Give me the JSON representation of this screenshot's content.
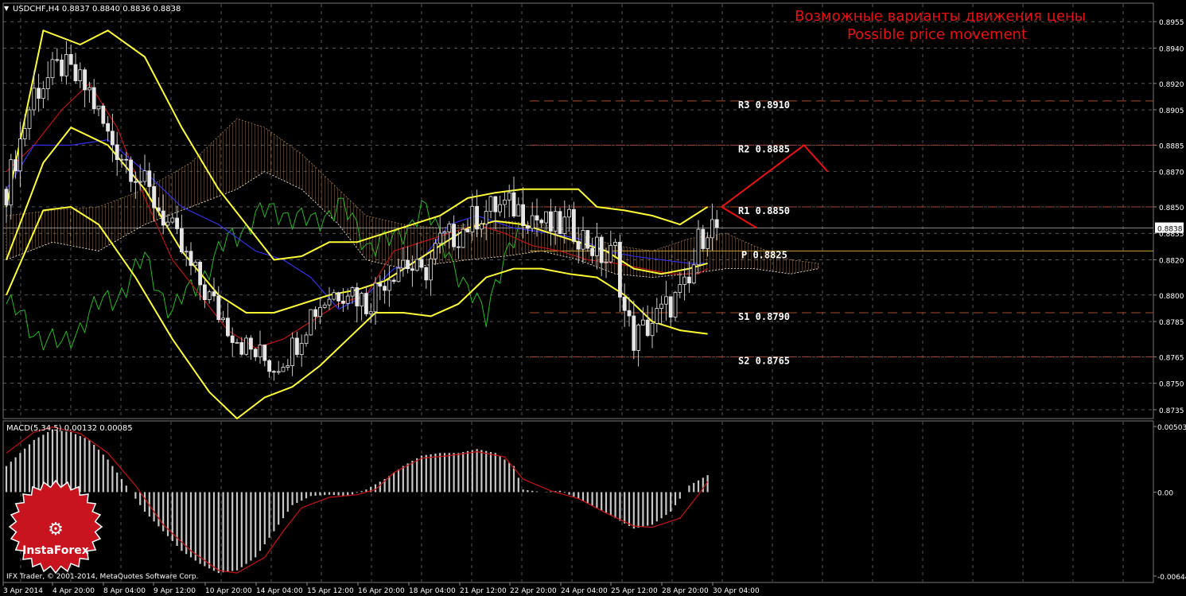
{
  "header": {
    "symbol_info": "USDCHF,H4  0.8837 0.8840 0.8836 0.8838",
    "macd_info": "MACD(5,34,5) 0.00132 0.00085",
    "copyright": "IFX Trader, © 2001-2014, MetaQuotes Software Corp."
  },
  "annotation": {
    "title_ru": "Возможные варианты движения цены",
    "title_en": "Possible price movement"
  },
  "logo": {
    "text": "InstaForex"
  },
  "colors": {
    "background": "#000000",
    "grid": "#8a8a8a",
    "bollinger": "#ffff33",
    "candle": "#e6e6e6",
    "tenkan": "#3333ff",
    "kijun": "#cc1111",
    "chikou": "#22bb22",
    "kumo_a": "#b08a5a",
    "kumo_b": "#ffffff",
    "level_line": "#a84a2a",
    "pivot_line": "#c8a02a",
    "bid_line": "#9a9a9a",
    "forecast": "#e81010",
    "annotation": "#e81010",
    "macd_hist": "#c8c8c8",
    "macd_signal": "#cc1111",
    "axis_text": "#ffffff"
  },
  "chart_data": [
    {
      "type": "candlestick",
      "title": "USDCHF,H4",
      "ylim": [
        0.873,
        0.8965
      ],
      "y_ticks": [
        "0.8955",
        "0.8940",
        "0.8920",
        "0.8905",
        "0.8885",
        "0.8870",
        "0.8850",
        "0.8835",
        "0.8820",
        "0.8800",
        "0.8785",
        "0.8765",
        "0.8750",
        "0.8735"
      ],
      "current_price_label": "0.8838",
      "x_ticks": [
        "3 Apr 2014",
        "4 Apr 20:00",
        "8 Apr 04:00",
        "9 Apr 12:00",
        "10 Apr 20:00",
        "14 Apr 04:00",
        "15 Apr 12:00",
        "16 Apr 20:00",
        "18 Apr 04:00",
        "21 Apr 12:00",
        "22 Apr 20:00",
        "24 Apr 04:00",
        "25 Apr 12:00",
        "28 Apr 20:00",
        "30 Apr 04:00"
      ],
      "levels": [
        {
          "label": "R3  0.8910",
          "value": 0.891
        },
        {
          "label": "R2  0.8885",
          "value": 0.8885
        },
        {
          "label": "R1  0.8850",
          "value": 0.885
        },
        {
          "label": "P  0.8825",
          "value": 0.8825
        },
        {
          "label": "S1  0.8790",
          "value": 0.879
        },
        {
          "label": "S2  0.8765",
          "value": 0.8765
        }
      ],
      "current_price": 0.8838,
      "close_path": [
        [
          0,
          0.886
        ],
        [
          6,
          0.8915
        ],
        [
          12,
          0.893
        ],
        [
          18,
          0.8915
        ],
        [
          22,
          0.889
        ],
        [
          28,
          0.887
        ],
        [
          34,
          0.8845
        ],
        [
          40,
          0.8815
        ],
        [
          46,
          0.879
        ],
        [
          52,
          0.877
        ],
        [
          58,
          0.876
        ],
        [
          62,
          0.877
        ],
        [
          66,
          0.879
        ],
        [
          70,
          0.88
        ],
        [
          74,
          0.8805
        ],
        [
          78,
          0.8795
        ],
        [
          82,
          0.881
        ],
        [
          86,
          0.882
        ],
        [
          90,
          0.881
        ],
        [
          94,
          0.883
        ],
        [
          98,
          0.8835
        ],
        [
          102,
          0.8845
        ],
        [
          106,
          0.885
        ],
        [
          110,
          0.885
        ],
        [
          114,
          0.8845
        ],
        [
          118,
          0.8838
        ],
        [
          122,
          0.884
        ],
        [
          126,
          0.883
        ],
        [
          130,
          0.882
        ],
        [
          132,
          0.8825
        ],
        [
          134,
          0.879
        ],
        [
          136,
          0.8775
        ],
        [
          140,
          0.8785
        ],
        [
          144,
          0.8795
        ],
        [
          148,
          0.8805
        ],
        [
          150,
          0.883
        ],
        [
          152,
          0.884
        ],
        [
          154,
          0.8838
        ]
      ],
      "bollinger_upper": [
        [
          0,
          0.885
        ],
        [
          8,
          0.895
        ],
        [
          16,
          0.8942
        ],
        [
          22,
          0.895
        ],
        [
          30,
          0.8935
        ],
        [
          38,
          0.8895
        ],
        [
          46,
          0.886
        ],
        [
          52,
          0.884
        ],
        [
          58,
          0.882
        ],
        [
          64,
          0.8822
        ],
        [
          70,
          0.883
        ],
        [
          76,
          0.883
        ],
        [
          82,
          0.8835
        ],
        [
          88,
          0.884
        ],
        [
          94,
          0.8845
        ],
        [
          100,
          0.8855
        ],
        [
          106,
          0.8858
        ],
        [
          112,
          0.886
        ],
        [
          118,
          0.886
        ],
        [
          124,
          0.886
        ],
        [
          128,
          0.885
        ],
        [
          134,
          0.8848
        ],
        [
          140,
          0.8845
        ],
        [
          146,
          0.884
        ],
        [
          152,
          0.885
        ]
      ],
      "bollinger_middle": [
        [
          0,
          0.882
        ],
        [
          8,
          0.8875
        ],
        [
          14,
          0.8895
        ],
        [
          22,
          0.8885
        ],
        [
          30,
          0.886
        ],
        [
          38,
          0.8825
        ],
        [
          46,
          0.88
        ],
        [
          52,
          0.879
        ],
        [
          58,
          0.879
        ],
        [
          64,
          0.8795
        ],
        [
          70,
          0.88
        ],
        [
          76,
          0.8803
        ],
        [
          82,
          0.8808
        ],
        [
          88,
          0.8818
        ],
        [
          94,
          0.8828
        ],
        [
          100,
          0.8838
        ],
        [
          106,
          0.8842
        ],
        [
          112,
          0.884
        ],
        [
          118,
          0.8835
        ],
        [
          124,
          0.883
        ],
        [
          130,
          0.8825
        ],
        [
          136,
          0.8815
        ],
        [
          142,
          0.8812
        ],
        [
          148,
          0.8815
        ],
        [
          152,
          0.8818
        ]
      ],
      "bollinger_lower": [
        [
          0,
          0.88
        ],
        [
          8,
          0.8848
        ],
        [
          14,
          0.885
        ],
        [
          20,
          0.884
        ],
        [
          28,
          0.881
        ],
        [
          36,
          0.8775
        ],
        [
          44,
          0.8745
        ],
        [
          50,
          0.873
        ],
        [
          56,
          0.8742
        ],
        [
          62,
          0.8748
        ],
        [
          68,
          0.876
        ],
        [
          74,
          0.8775
        ],
        [
          80,
          0.879
        ],
        [
          86,
          0.879
        ],
        [
          92,
          0.8788
        ],
        [
          98,
          0.8795
        ],
        [
          104,
          0.881
        ],
        [
          110,
          0.8815
        ],
        [
          116,
          0.8815
        ],
        [
          122,
          0.8812
        ],
        [
          128,
          0.881
        ],
        [
          134,
          0.88
        ],
        [
          140,
          0.8785
        ],
        [
          146,
          0.878
        ],
        [
          152,
          0.8778
        ]
      ],
      "tenkan": [
        [
          0,
          0.886
        ],
        [
          6,
          0.8885
        ],
        [
          14,
          0.8885
        ],
        [
          22,
          0.8888
        ],
        [
          30,
          0.887
        ],
        [
          38,
          0.885
        ],
        [
          46,
          0.884
        ],
        [
          54,
          0.8825
        ],
        [
          60,
          0.882
        ],
        [
          66,
          0.881
        ],
        [
          72,
          0.8792
        ],
        [
          78,
          0.88
        ],
        [
          84,
          0.8815
        ],
        [
          90,
          0.882
        ],
        [
          96,
          0.884
        ],
        [
          102,
          0.8845
        ],
        [
          110,
          0.8838
        ],
        [
          118,
          0.8835
        ],
        [
          124,
          0.8832
        ],
        [
          130,
          0.8825
        ],
        [
          136,
          0.8822
        ],
        [
          142,
          0.882
        ],
        [
          148,
          0.8818
        ],
        [
          152,
          0.8818
        ]
      ],
      "kijun": [
        [
          0,
          0.887
        ],
        [
          6,
          0.8885
        ],
        [
          12,
          0.8905
        ],
        [
          18,
          0.892
        ],
        [
          24,
          0.8895
        ],
        [
          30,
          0.8855
        ],
        [
          36,
          0.882
        ],
        [
          42,
          0.88
        ],
        [
          48,
          0.878
        ],
        [
          54,
          0.877
        ],
        [
          60,
          0.8775
        ],
        [
          66,
          0.8785
        ],
        [
          72,
          0.8795
        ],
        [
          78,
          0.88
        ],
        [
          84,
          0.8825
        ],
        [
          90,
          0.883
        ],
        [
          96,
          0.8835
        ],
        [
          102,
          0.884
        ],
        [
          108,
          0.8835
        ],
        [
          114,
          0.8828
        ],
        [
          120,
          0.8825
        ],
        [
          126,
          0.882
        ],
        [
          132,
          0.8818
        ],
        [
          138,
          0.8815
        ],
        [
          144,
          0.8812
        ],
        [
          150,
          0.8812
        ],
        [
          152,
          0.8815
        ]
      ],
      "chikou": [
        [
          0,
          0.8795
        ],
        [
          6,
          0.878
        ],
        [
          12,
          0.877
        ],
        [
          18,
          0.879
        ],
        [
          24,
          0.88
        ],
        [
          30,
          0.882
        ],
        [
          36,
          0.879
        ],
        [
          42,
          0.881
        ],
        [
          48,
          0.883
        ],
        [
          54,
          0.8845
        ],
        [
          60,
          0.8848
        ],
        [
          66,
          0.884
        ],
        [
          72,
          0.8852
        ],
        [
          78,
          0.883
        ],
        [
          84,
          0.883
        ],
        [
          90,
          0.885
        ],
        [
          96,
          0.8825
        ],
        [
          100,
          0.88
        ],
        [
          104,
          0.879
        ],
        [
          106,
          0.881
        ],
        [
          112,
          0.8838
        ]
      ],
      "kumo": [
        [
          0,
          0.8845,
          0.882
        ],
        [
          10,
          0.8848,
          0.883
        ],
        [
          20,
          0.885,
          0.8825
        ],
        [
          30,
          0.886,
          0.884
        ],
        [
          40,
          0.8875,
          0.885
        ],
        [
          50,
          0.89,
          0.886
        ],
        [
          56,
          0.8895,
          0.887
        ],
        [
          64,
          0.888,
          0.886
        ],
        [
          72,
          0.886,
          0.884
        ],
        [
          78,
          0.8845,
          0.882
        ],
        [
          86,
          0.884,
          0.8815
        ],
        [
          94,
          0.8838,
          0.8818
        ],
        [
          100,
          0.884,
          0.882
        ],
        [
          108,
          0.8842,
          0.8822
        ],
        [
          116,
          0.884,
          0.8825
        ],
        [
          124,
          0.8835,
          0.882
        ],
        [
          132,
          0.8828,
          0.8812
        ],
        [
          140,
          0.8825,
          0.881
        ],
        [
          148,
          0.8832,
          0.8812
        ],
        [
          156,
          0.8835,
          0.8815
        ],
        [
          162,
          0.8828,
          0.8815
        ],
        [
          170,
          0.882,
          0.8812
        ],
        [
          176,
          0.8818,
          0.8815
        ]
      ],
      "forecast_paths": [
        [
          [
            0.885,
            0
          ],
          [
            0.8885,
            14
          ],
          [
            0.887,
            18
          ]
        ],
        [
          [
            0.885,
            0
          ],
          [
            0.8838,
            6
          ]
        ]
      ]
    },
    {
      "type": "bar",
      "title": "MACD(5,34,5) 0.00132 0.00085",
      "ylim": [
        -0.00644,
        0.00503
      ],
      "y_ticks": [
        "0.00503",
        "0.00",
        "-0.00644"
      ],
      "histogram": [
        [
          0,
          0.002
        ],
        [
          6,
          0.004
        ],
        [
          10,
          0.0048
        ],
        [
          14,
          0.0046
        ],
        [
          18,
          0.004
        ],
        [
          22,
          0.0025
        ],
        [
          26,
          0.0005
        ],
        [
          30,
          -0.0015
        ],
        [
          34,
          -0.003
        ],
        [
          38,
          -0.0045
        ],
        [
          42,
          -0.0055
        ],
        [
          46,
          -0.0062
        ],
        [
          50,
          -0.006
        ],
        [
          54,
          -0.005
        ],
        [
          58,
          -0.003
        ],
        [
          62,
          -0.001
        ],
        [
          66,
          -0.0003
        ],
        [
          70,
          -0.0002
        ],
        [
          74,
          -0.0003
        ],
        [
          78,
          0.0002
        ],
        [
          82,
          0.001
        ],
        [
          86,
          0.002
        ],
        [
          90,
          0.0028
        ],
        [
          94,
          0.003
        ],
        [
          98,
          0.003
        ],
        [
          102,
          0.0033
        ],
        [
          106,
          0.003
        ],
        [
          110,
          0.002
        ],
        [
          112,
          0.0002
        ],
        [
          116,
          0.0
        ],
        [
          120,
          0.0001
        ],
        [
          124,
          -0.0005
        ],
        [
          128,
          -0.0012
        ],
        [
          132,
          -0.002
        ],
        [
          136,
          -0.0028
        ],
        [
          140,
          -0.0025
        ],
        [
          144,
          -0.0015
        ],
        [
          148,
          0.0005
        ],
        [
          152,
          0.0013
        ]
      ],
      "signal": [
        [
          0,
          0.003
        ],
        [
          6,
          0.0046
        ],
        [
          10,
          0.005
        ],
        [
          16,
          0.0045
        ],
        [
          22,
          0.003
        ],
        [
          28,
          0.0005
        ],
        [
          34,
          -0.0025
        ],
        [
          40,
          -0.0045
        ],
        [
          46,
          -0.006
        ],
        [
          50,
          -0.0062
        ],
        [
          56,
          -0.005
        ],
        [
          60,
          -0.003
        ],
        [
          64,
          -0.0012
        ],
        [
          70,
          -0.0004
        ],
        [
          76,
          -0.0002
        ],
        [
          80,
          0.0002
        ],
        [
          84,
          0.0015
        ],
        [
          90,
          0.0026
        ],
        [
          96,
          0.0028
        ],
        [
          102,
          0.0031
        ],
        [
          108,
          0.0027
        ],
        [
          112,
          0.001
        ],
        [
          118,
          0.0001
        ],
        [
          124,
          -0.0005
        ],
        [
          130,
          -0.0016
        ],
        [
          136,
          -0.0026
        ],
        [
          140,
          -0.0027
        ],
        [
          146,
          -0.002
        ],
        [
          150,
          -0.0002
        ],
        [
          152,
          0.0008
        ]
      ]
    }
  ]
}
